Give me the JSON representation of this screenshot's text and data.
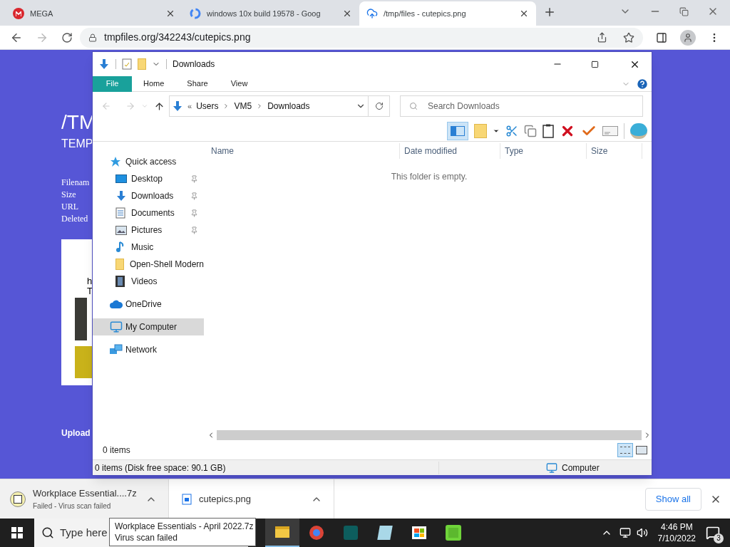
{
  "browser": {
    "tabs": [
      {
        "title": "MEGA",
        "kind": "mega",
        "selected": false
      },
      {
        "title": "windows 10x build 19578 - Goog",
        "kind": "google",
        "selected": false
      },
      {
        "title": "/tmp/files - cutepics.png",
        "kind": "cloud",
        "selected": true
      }
    ],
    "address": "tmpfiles.org/342243/cutepics.png"
  },
  "page": {
    "heading": "/TM",
    "subheading": "TEMP",
    "labels": [
      "Filenam",
      "Size",
      "URL",
      "Deleted"
    ],
    "card_texts": [
      "h",
      "T"
    ],
    "upload": "Upload"
  },
  "explorer": {
    "title": "Downloads",
    "ribbon_tabs": [
      {
        "label": "File",
        "selected": true
      },
      {
        "label": "Home",
        "selected": false
      },
      {
        "label": "Share",
        "selected": false
      },
      {
        "label": "View",
        "selected": false
      }
    ],
    "breadcrumb_overflow": "«",
    "breadcrumb": [
      "Users",
      "VM5",
      "Downloads"
    ],
    "search": {
      "placeholder": "Search Downloads"
    },
    "nav": [
      {
        "label": "Quick access",
        "kind": "star",
        "selected": false,
        "children": [
          {
            "label": "Desktop",
            "kind": "desktop",
            "pinned": true,
            "selected": false
          },
          {
            "label": "Downloads",
            "kind": "download",
            "pinned": true,
            "selected": false
          },
          {
            "label": "Documents",
            "kind": "document",
            "pinned": true,
            "selected": false
          },
          {
            "label": "Pictures",
            "kind": "picture",
            "pinned": true,
            "selected": false
          },
          {
            "label": "Music",
            "kind": "music",
            "pinned": false,
            "selected": false
          },
          {
            "label": "Open-Shell Modern",
            "kind": "folder",
            "pinned": false,
            "selected": false
          },
          {
            "label": "Videos",
            "kind": "video",
            "pinned": false,
            "selected": false
          }
        ]
      },
      {
        "label": "OneDrive",
        "kind": "cloud",
        "selected": false
      },
      {
        "label": "My Computer",
        "kind": "computer",
        "selected": true
      },
      {
        "label": "Network",
        "kind": "network",
        "selected": false
      }
    ],
    "columns": [
      "Name",
      "Date modified",
      "Type",
      "Size"
    ],
    "empty_message": "This folder is empty.",
    "item_count": "0 items",
    "status": "0 items (Disk free space: 90.1 GB)",
    "location": "Computer"
  },
  "downloads": {
    "items": [
      {
        "name": "Workplace Essential....7z",
        "status": "Failed - Virus scan failed",
        "kind": "archive"
      },
      {
        "name": "cutepics.png",
        "kind": "image"
      }
    ],
    "show_all": "Show all"
  },
  "taskbar": {
    "search": {
      "placeholder": "Type here"
    },
    "tooltip": [
      "Workplace Essentials - April 2022.7z",
      "Virus scan failed"
    ],
    "time": "4:46 PM",
    "date": "7/10/2022",
    "notifications": "3"
  }
}
